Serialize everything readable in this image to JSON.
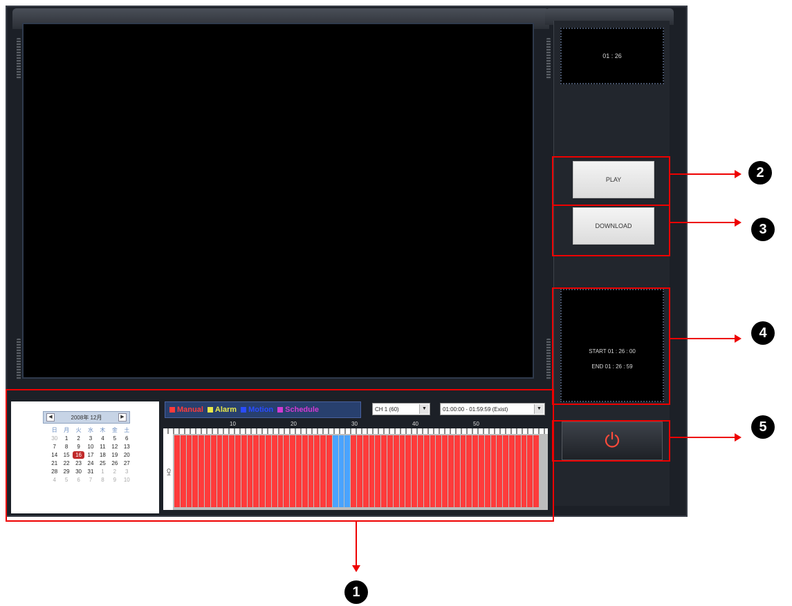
{
  "clock": "01 : 26",
  "buttons": {
    "play": "PLAY",
    "download": "DOWNLOAD"
  },
  "time_range": {
    "start": "START  01 : 26 : 00",
    "end": "END    01 : 26 : 59"
  },
  "calendar": {
    "month_label": "2008年 12月",
    "weekday_headers": [
      "日",
      "月",
      "火",
      "水",
      "木",
      "金",
      "土"
    ],
    "days": [
      {
        "t": "30",
        "dim": true
      },
      {
        "t": "1"
      },
      {
        "t": "2"
      },
      {
        "t": "3"
      },
      {
        "t": "4"
      },
      {
        "t": "5"
      },
      {
        "t": "6"
      },
      {
        "t": "7"
      },
      {
        "t": "8"
      },
      {
        "t": "9"
      },
      {
        "t": "10"
      },
      {
        "t": "11"
      },
      {
        "t": "12"
      },
      {
        "t": "13"
      },
      {
        "t": "14"
      },
      {
        "t": "15"
      },
      {
        "t": "16",
        "sel": true
      },
      {
        "t": "17"
      },
      {
        "t": "18"
      },
      {
        "t": "19"
      },
      {
        "t": "20"
      },
      {
        "t": "21"
      },
      {
        "t": "22"
      },
      {
        "t": "23"
      },
      {
        "t": "24"
      },
      {
        "t": "25"
      },
      {
        "t": "26"
      },
      {
        "t": "27"
      },
      {
        "t": "28"
      },
      {
        "t": "29"
      },
      {
        "t": "30"
      },
      {
        "t": "31"
      },
      {
        "t": "1",
        "dim": true
      },
      {
        "t": "2",
        "dim": true
      },
      {
        "t": "3",
        "dim": true
      },
      {
        "t": "4",
        "dim": true
      },
      {
        "t": "5",
        "dim": true
      },
      {
        "t": "6",
        "dim": true
      },
      {
        "t": "7",
        "dim": true
      },
      {
        "t": "8",
        "dim": true
      },
      {
        "t": "9",
        "dim": true
      },
      {
        "t": "10",
        "dim": true
      }
    ]
  },
  "legend": [
    {
      "label": "Manual",
      "color": "#ff3b3b"
    },
    {
      "label": "Alarm",
      "color": "#e8e84a"
    },
    {
      "label": "Motion",
      "color": "#2a4cff"
    },
    {
      "label": "Schedule",
      "color": "#d23ad2"
    }
  ],
  "channel_select": "CH 1 (60)",
  "time_select": "01:00:00 - 01:59:59 (Exist)",
  "timeline": {
    "ruler_labels": [
      "10",
      "20",
      "30",
      "40",
      "50"
    ],
    "row_label": "CH",
    "minutes": 60,
    "minute_states": [
      "manual",
      "manual",
      "manual",
      "manual",
      "manual",
      "manual",
      "manual",
      "manual",
      "manual",
      "manual",
      "manual",
      "manual",
      "manual",
      "manual",
      "manual",
      "manual",
      "manual",
      "manual",
      "manual",
      "manual",
      "manual",
      "manual",
      "manual",
      "manual",
      "manual",
      "manual",
      "manual",
      "manual",
      "manual",
      "manual",
      "manual",
      "manual",
      "manual",
      "manual",
      "manual",
      "manual",
      "manual",
      "manual",
      "manual",
      "manual",
      "manual",
      "manual",
      "manual",
      "manual",
      "manual",
      "manual",
      "manual",
      "manual",
      "manual",
      "manual",
      "manual",
      "manual",
      "manual",
      "manual",
      "manual",
      "manual",
      "manual",
      "manual",
      "manual",
      "manual"
    ],
    "selected_minute_range": [
      26,
      29
    ]
  },
  "annotations": [
    "1",
    "2",
    "3",
    "4",
    "5"
  ],
  "colors": {
    "annotation": "#e00000",
    "manual": "#ff3b3b",
    "selection": "#4aa3ff"
  }
}
